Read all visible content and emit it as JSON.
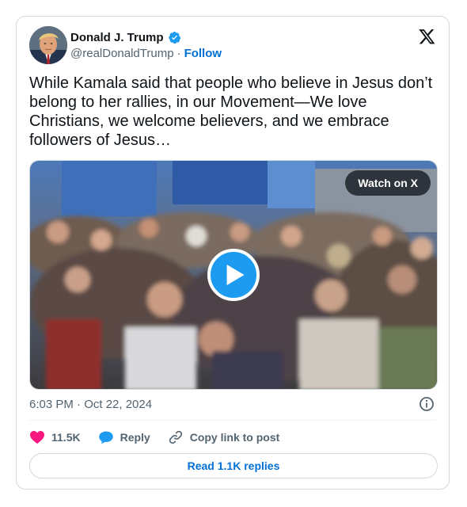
{
  "author": {
    "name": "Donald J. Trump",
    "handle": "@realDonaldTrump",
    "separator": "·",
    "follow_label": "Follow",
    "verified": true
  },
  "tweet": {
    "text": "While Kamala said that people who believe in Jesus don’t belong to her rallies, in our Movement—We love Christians, we welcome believers, and we embrace followers of Jesus…",
    "timestamp": "6:03 PM · Oct 22, 2024"
  },
  "media": {
    "type": "video",
    "watch_label": "Watch on X"
  },
  "actions": {
    "likes": "11.5K",
    "reply_label": "Reply",
    "copy_link_label": "Copy link to post"
  },
  "read_replies_label": "Read 1.1K replies",
  "colors": {
    "accent": "#1d9bf0",
    "link": "#006fd6",
    "like": "#f91880",
    "muted": "#536471",
    "border": "#cfd9de"
  },
  "icons": {
    "brand": "x-logo-icon",
    "verified": "verified-badge-icon",
    "play": "play-icon",
    "info": "info-icon",
    "like": "heart-icon",
    "reply": "speech-bubble-icon",
    "copy_link": "link-icon"
  }
}
